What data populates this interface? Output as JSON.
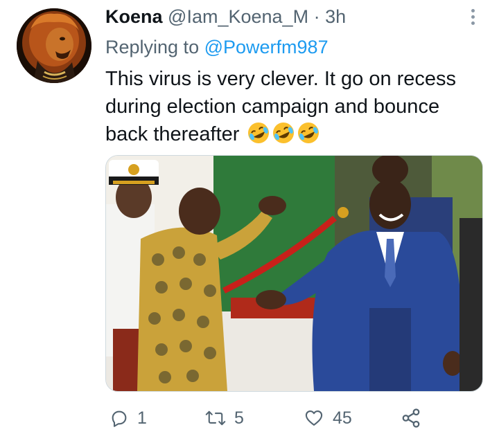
{
  "tweet": {
    "author_name": "Koena",
    "author_handle": "@Iam_Koena_M",
    "separator": "·",
    "time": "3h",
    "replying_prefix": "Replying to",
    "replying_to": "@Powerfm987",
    "text": "This virus is very clever. It go on recess during election campaign and bounce back thereafter",
    "emoji": [
      "rolling-on-floor-laughing",
      "rolling-on-floor-laughing",
      "rolling-on-floor-laughing"
    ]
  },
  "actions": {
    "reply_count": "1",
    "retweet_count": "5",
    "like_count": "45"
  },
  "icons": {
    "more": "more-vertical-icon",
    "reply": "reply-icon",
    "retweet": "retweet-icon",
    "like": "heart-icon",
    "share": "share-icon"
  },
  "colors": {
    "link": "#1d9bf0",
    "secondary_text": "#536471",
    "primary_text": "#0f1419"
  }
}
